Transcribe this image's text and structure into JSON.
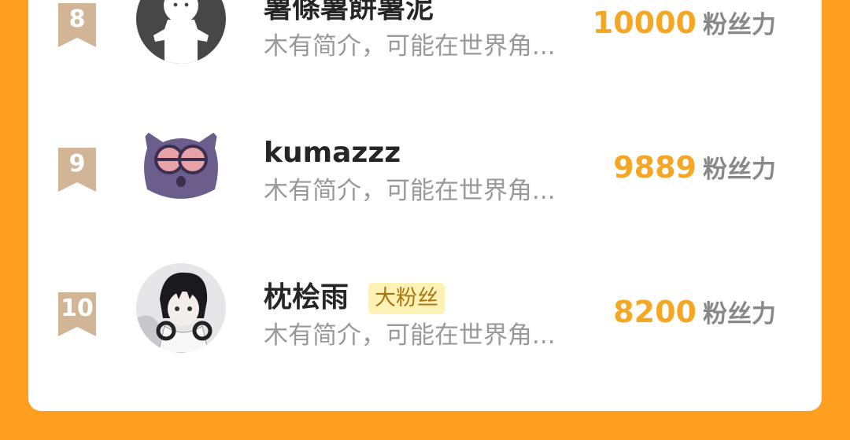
{
  "ranking": {
    "rows": [
      {
        "rank": "8",
        "name": "薯條薯餅薯泥",
        "badge": "",
        "bio": "木有简介，可能在世界角...",
        "value": "10000",
        "unit": "粉丝力",
        "avatar": "default-person-avatar"
      },
      {
        "rank": "9",
        "name": "kumazzz",
        "badge": "",
        "bio": "木有简介，可能在世界角...",
        "value": "9889",
        "unit": "粉丝力",
        "avatar": "purple-cat-avatar"
      },
      {
        "rank": "10",
        "name": "枕桧雨",
        "badge": "大粉丝",
        "bio": "木有简介，可能在世界角...",
        "value": "8200",
        "unit": "粉丝力",
        "avatar": "anime-boy-headphones-avatar"
      }
    ]
  },
  "colors": {
    "background": "#FF9F1F",
    "card": "#FFFFFF",
    "value": "#F5A623",
    "rank_ribbon": "#D2B596",
    "badge_bg": "#FEF1B6",
    "badge_text": "#A5760E"
  }
}
